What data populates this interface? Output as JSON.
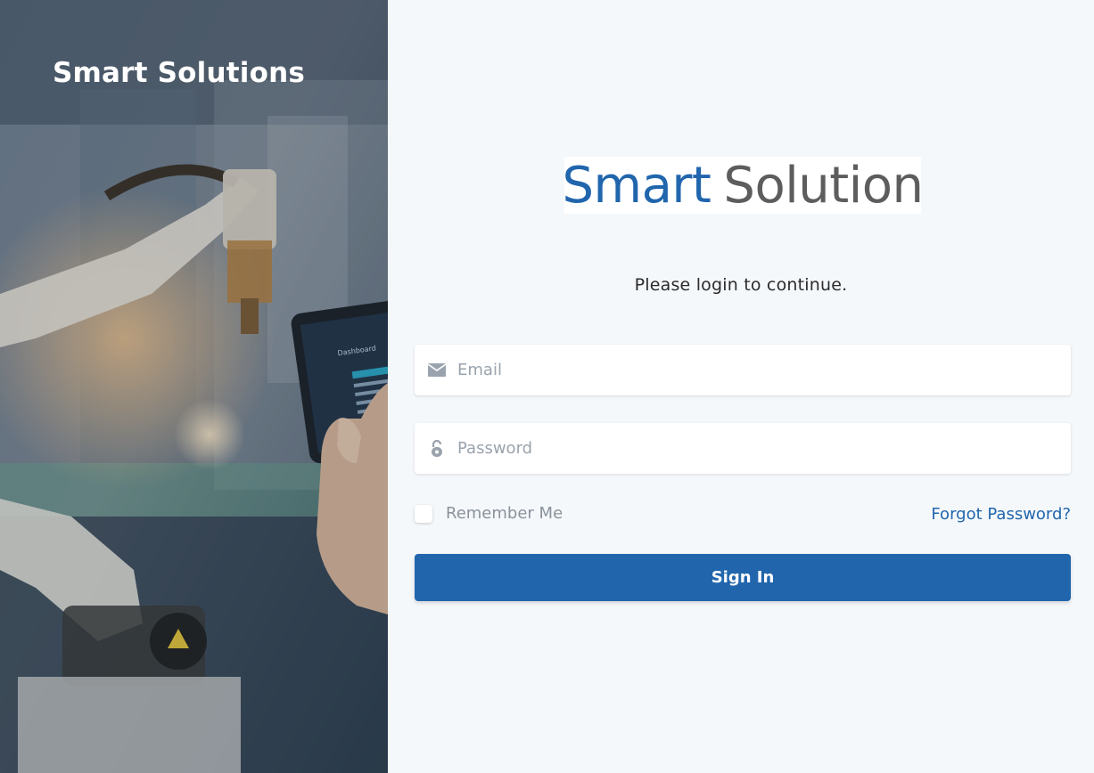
{
  "hero": {
    "title": "Smart Solutions",
    "tablet_menu_title": "Dashboard"
  },
  "login": {
    "brand_part1": "Smart",
    "brand_part2": "Solution",
    "subtitle": "Please login to continue.",
    "email_placeholder": "Email",
    "password_placeholder": "Password",
    "remember_label": "Remember Me",
    "forgot_label": "Forgot Password?",
    "signin_label": "Sign In",
    "email_icon": "envelope-icon",
    "password_icon": "lock-icon"
  },
  "colors": {
    "accent": "#2166ad",
    "brand_grey": "#5d5d5d",
    "panel_bg": "#f5f8fb"
  }
}
